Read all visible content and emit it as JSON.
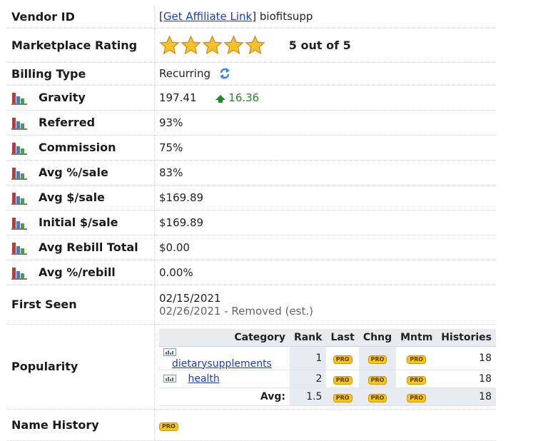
{
  "vendor": {
    "label": "Vendor ID",
    "bracket_open": "[",
    "affiliate_link": "Get Affiliate Link",
    "bracket_close": "]",
    "id": "biofitsupp"
  },
  "rating": {
    "label": "Marketplace Rating",
    "stars": 5,
    "text": "5 out of 5"
  },
  "billing": {
    "label": "Billing Type",
    "value": "Recurring"
  },
  "stats": [
    {
      "label": "Gravity",
      "value": "197.41",
      "change": "16.36"
    },
    {
      "label": "Referred",
      "value": "93%"
    },
    {
      "label": "Commission",
      "value": "75%"
    },
    {
      "label": "Avg %/sale",
      "value": "83%"
    },
    {
      "label": "Avg $/sale",
      "value": "$169.89"
    },
    {
      "label": "Initial $/sale",
      "value": "$169.89"
    },
    {
      "label": "Avg Rebill Total",
      "value": "$0.00"
    },
    {
      "label": "Avg %/rebill",
      "value": "0.00%"
    }
  ],
  "first_seen": {
    "label": "First Seen",
    "date": "02/15/2021",
    "removed": "02/26/2021 - Removed (est.)"
  },
  "popularity": {
    "label": "Popularity",
    "headers": [
      "Category",
      "Rank",
      "Last",
      "Chng",
      "Mntm",
      "Histories"
    ],
    "rows": [
      {
        "category": "dietarysupplements",
        "rank": "1",
        "histories": "18"
      },
      {
        "category": "health",
        "rank": "2",
        "histories": "18"
      }
    ],
    "avg_label": "Avg:",
    "avg_rank": "1.5",
    "avg_histories": "18",
    "pro_badge": "PRO"
  },
  "name_history": {
    "label": "Name History",
    "badge": "PRO"
  },
  "colors": {
    "link": "#1a3fb3",
    "up": "#1f8a24",
    "pro": "#f5c518"
  }
}
